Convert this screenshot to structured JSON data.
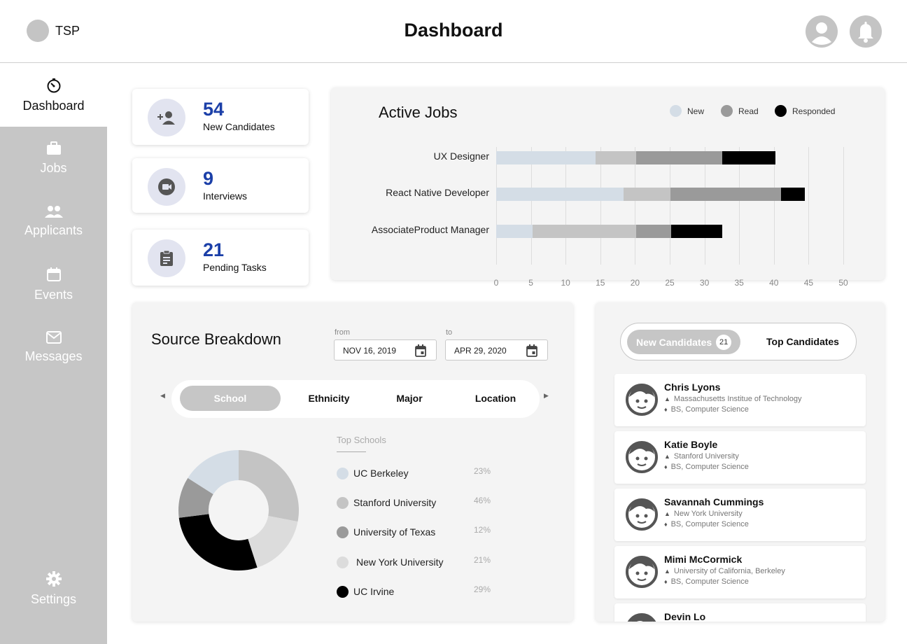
{
  "header": {
    "brand": "TSP",
    "title": "Dashboard",
    "icons": [
      "user-icon",
      "bell-icon"
    ]
  },
  "sidebar": {
    "items": [
      {
        "label": "Dashboard",
        "icon": "dashboard-icon",
        "active": true
      },
      {
        "label": "Jobs",
        "icon": "briefcase-icon"
      },
      {
        "label": "Applicants",
        "icon": "people-icon"
      },
      {
        "label": "Events",
        "icon": "calendar-icon"
      },
      {
        "label": "Messages",
        "icon": "mail-icon"
      },
      {
        "label": "Settings",
        "icon": "gear-icon"
      }
    ]
  },
  "stats": [
    {
      "value": "54",
      "label": "New Candidates",
      "icon": "add-person-icon"
    },
    {
      "value": "9",
      "label": "Interviews",
      "icon": "video-icon"
    },
    {
      "value": "21",
      "label": "Pending Tasks",
      "icon": "clipboard-icon"
    }
  ],
  "active_jobs": {
    "title": "Active Jobs",
    "legend": [
      {
        "label": "New",
        "color": "#d4dde6"
      },
      {
        "label": "Read",
        "color": "#9a9a9a"
      },
      {
        "label": "Responded",
        "color": "#000000"
      }
    ],
    "ticks": [
      "0",
      "5",
      "10",
      "15",
      "20",
      "25",
      "30",
      "35",
      "40",
      "45",
      "50"
    ]
  },
  "chart_data": [
    {
      "type": "bar",
      "title": "Active Jobs",
      "orientation": "horizontal",
      "stacked": true,
      "categories": [
        "UX Designer",
        "React Native Developer",
        "AssociateProduct Manager"
      ],
      "series": [
        {
          "name": "New",
          "values": [
            14.3,
            18.3,
            5.2
          ]
        },
        {
          "name": "Read",
          "values": [
            20.3,
            21.6,
            20.3
          ]
        },
        {
          "name": "Responded",
          "values": [
            7.6,
            3.5,
            7.4
          ]
        }
      ],
      "segments": [
        [
          {
            "value": 14.3,
            "color": "#d4dde6"
          },
          {
            "value": 5.9,
            "color": "#c4c4c4"
          },
          {
            "value": 12.4,
            "color": "#9a9a9a"
          },
          {
            "value": 7.6,
            "color": "#000000"
          }
        ],
        [
          {
            "value": 18.3,
            "color": "#d4dde6"
          },
          {
            "value": 6.8,
            "color": "#c4c4c4"
          },
          {
            "value": 15.9,
            "color": "#9a9a9a"
          },
          {
            "value": 3.5,
            "color": "#000000"
          }
        ],
        [
          {
            "value": 5.2,
            "color": "#d4dde6"
          },
          {
            "value": 15.0,
            "color": "#c4c4c4"
          },
          {
            "value": 5.0,
            "color": "#9a9a9a"
          },
          {
            "value": 7.4,
            "color": "#000000"
          }
        ]
      ],
      "xlim": [
        0,
        50
      ],
      "grid": true,
      "legend_position": "top-right"
    },
    {
      "type": "pie",
      "donut": true,
      "title": "Top Schools",
      "labels": [
        "UC Berkeley",
        "Stanford University",
        "University of Texas",
        "New York University",
        "UC Irvine"
      ],
      "values": [
        23,
        46,
        12,
        21,
        29
      ],
      "slices_visual": [
        {
          "label": "Stanford University",
          "percent": 28,
          "color": "#c4c4c4"
        },
        {
          "label": "New York University",
          "percent": 17,
          "color": "#dcdcdc"
        },
        {
          "label": "UC Irvine",
          "percent": 28,
          "color": "#000000"
        },
        {
          "label": "University of Texas",
          "percent": 11,
          "color": "#9a9a9a"
        },
        {
          "label": "UC Berkeley",
          "percent": 16,
          "color": "#d4dde6"
        }
      ]
    }
  ],
  "source_breakdown": {
    "title": "Source Breakdown",
    "from_label": "from",
    "to_label": "to",
    "from_date": "NOV 16, 2019",
    "to_date": "APR 29, 2020",
    "tabs": [
      "School",
      "Ethnicity",
      "Major",
      "Location"
    ],
    "active_tab": "School",
    "list_title": "Top Schools",
    "schools": [
      {
        "name": "UC Berkeley",
        "pct": "23%",
        "color": "#d4dde6"
      },
      {
        "name": "Stanford University",
        "pct": "46%",
        "color": "#c4c4c4"
      },
      {
        "name": "University of Texas",
        "pct": "12%",
        "color": "#9a9a9a"
      },
      {
        "name": "New York University",
        "pct": "21%",
        "color": "#dcdcdc"
      },
      {
        "name": "UC Irvine",
        "pct": "29%",
        "color": "#000000"
      }
    ]
  },
  "candidates": {
    "tab_new": "New Candidates",
    "tab_new_count": "21",
    "tab_top": "Top Candidates",
    "list": [
      {
        "name": "Chris Lyons",
        "school": "Massachusetts Institue of Technology",
        "degree": "BS, Computer Science"
      },
      {
        "name": "Katie Boyle",
        "school": "Stanford University",
        "degree": "BS, Computer Science"
      },
      {
        "name": "Savannah Cummings",
        "school": "New York University",
        "degree": "BS, Computer Science"
      },
      {
        "name": "Mimi McCormick",
        "school": "University of California, Berkeley",
        "degree": "BS, Computer Science"
      },
      {
        "name": "Devin Lo",
        "school": "",
        "degree": ""
      }
    ]
  }
}
